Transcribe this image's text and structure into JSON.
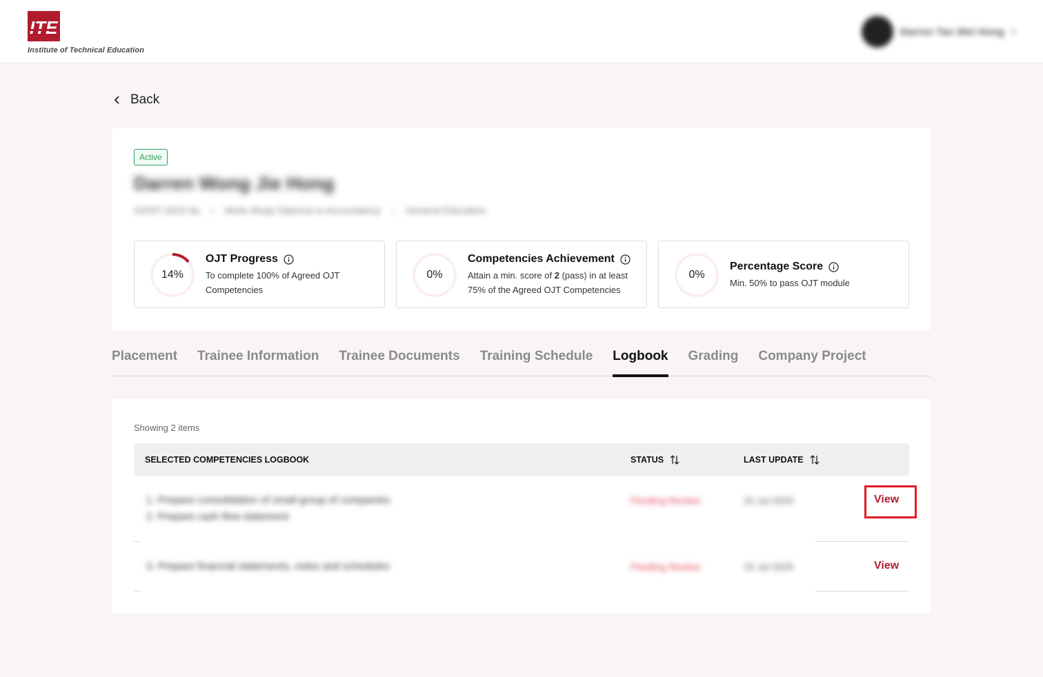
{
  "header": {
    "logo_caption": "Institute of Technical Education",
    "logo_mark": "ITE",
    "user_name": "Darren Tan Wei Hong"
  },
  "nav": {
    "back_label": "Back"
  },
  "trainee": {
    "status_badge": "Active",
    "name": "Darren Wong Jie Hong",
    "meta": [
      "2025T-2023-3a",
      "Work-Study Diploma in Accountancy",
      "General Education"
    ]
  },
  "stats": [
    {
      "value": "14%",
      "progress": 0.14,
      "title": "OJT Progress",
      "desc": "To complete 100% of Agreed OJT Competencies"
    },
    {
      "value": "0%",
      "progress": 0,
      "title": "Competencies Achievement",
      "desc_pre": "Attain a min. score of ",
      "desc_bold": "2",
      "desc_post": " (pass) in at least 75% of the Agreed OJT Competencies"
    },
    {
      "value": "0%",
      "progress": 0,
      "title": "Percentage Score",
      "desc": "Min. 50% to pass OJT module"
    }
  ],
  "tabs": [
    "Placement",
    "Trainee Information",
    "Trainee Documents",
    "Training Schedule",
    "Logbook",
    "Grading",
    "Company Project"
  ],
  "active_tab": "Logbook",
  "logbook": {
    "showing": "Showing 2 items",
    "columns": {
      "name": "SELECTED COMPETENCIES LOGBOOK",
      "status": "STATUS",
      "last_update": "LAST UPDATE"
    },
    "rows": [
      {
        "lines": [
          "1. Prepare consolidation of small group of companies",
          "2. Prepare cash flow statement"
        ],
        "status": "Pending Review",
        "last_update": "15 Jul 2025",
        "action": "View"
      },
      {
        "lines": [
          "3. Prepare financial statements, notes and schedules"
        ],
        "status": "Pending Review",
        "last_update": "15 Jul 2025",
        "action": "View"
      }
    ]
  },
  "colors": {
    "brand": "#b01c2e",
    "status_active": "#2e9e5b",
    "highlight": "#e31b23",
    "page_bg": "#f9f5f5"
  }
}
